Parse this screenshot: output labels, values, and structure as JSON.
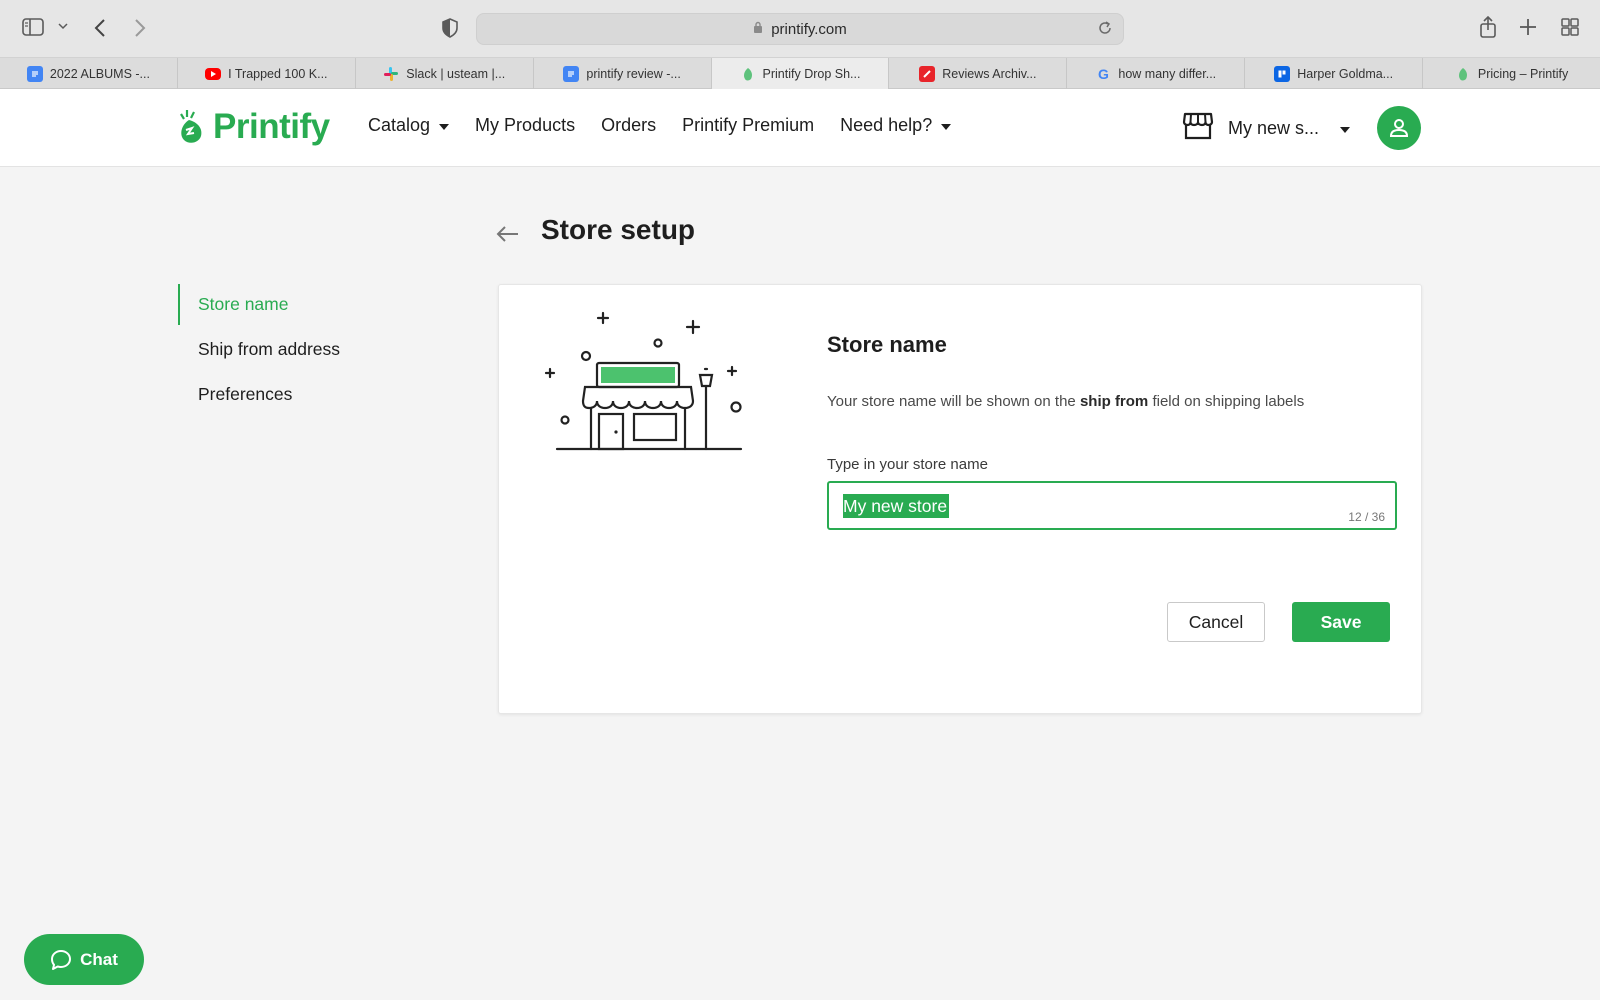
{
  "browser": {
    "url": "printify.com",
    "tabs": [
      {
        "label": "2022 ALBUMS -...",
        "icon": "google-docs-icon",
        "active": false
      },
      {
        "label": "I Trapped 100 K...",
        "icon": "youtube-icon",
        "active": false
      },
      {
        "label": "Slack | usteam |...",
        "icon": "slack-icon",
        "active": false
      },
      {
        "label": "printify review -...",
        "icon": "google-docs-icon",
        "active": false
      },
      {
        "label": "Printify Drop Sh...",
        "icon": "printify-icon",
        "active": true
      },
      {
        "label": "Reviews Archiv...",
        "icon": "reviews-icon",
        "active": false
      },
      {
        "label": "how many differ...",
        "icon": "google-icon",
        "active": false
      },
      {
        "label": "Harper Goldma...",
        "icon": "trello-icon",
        "active": false
      },
      {
        "label": "Pricing – Printify",
        "icon": "printify-icon",
        "active": false
      }
    ]
  },
  "header": {
    "logo_text": "Printify",
    "nav": {
      "catalog": "Catalog",
      "my_products": "My Products",
      "orders": "Orders",
      "premium": "Printify Premium",
      "help": "Need help?"
    },
    "store_selector": "My new s..."
  },
  "page": {
    "title": "Store setup",
    "side_nav": {
      "store_name": "Store name",
      "ship_from": "Ship from address",
      "preferences": "Preferences"
    }
  },
  "card": {
    "title": "Store name",
    "desc_before": "Your store name will be shown on the ",
    "desc_bold": "ship from",
    "desc_after": " field on shipping labels",
    "field_label": "Type in your store name",
    "field_value": "My new store",
    "counter": "12 / 36",
    "cancel": "Cancel",
    "save": "Save"
  },
  "chat": {
    "label": "Chat"
  },
  "colors": {
    "brand_green": "#29ab51"
  }
}
